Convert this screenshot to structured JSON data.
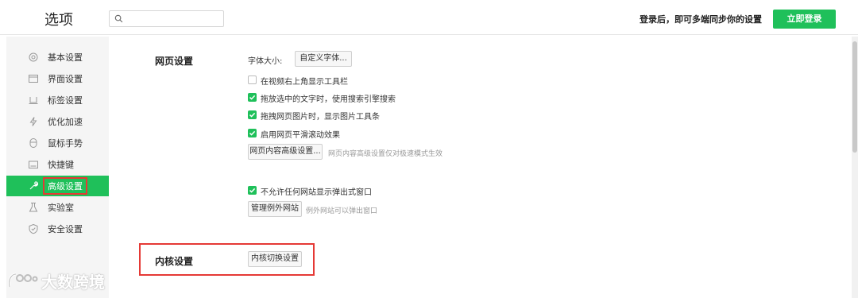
{
  "header": {
    "title": "选项",
    "search_placeholder": "",
    "sync_text": "登录后，即可多端同步你的设置",
    "login_button": "立即登录"
  },
  "sidebar": {
    "items": [
      {
        "label": "基本设置",
        "icon": "circle-icon"
      },
      {
        "label": "界面设置",
        "icon": "window-icon"
      },
      {
        "label": "标签设置",
        "icon": "tab-icon"
      },
      {
        "label": "优化加速",
        "icon": "lightning-icon"
      },
      {
        "label": "鼠标手势",
        "icon": "mouse-icon"
      },
      {
        "label": "快捷键",
        "icon": "keyboard-icon"
      },
      {
        "label": "高级设置",
        "icon": "wrench-icon",
        "active": true
      },
      {
        "label": "实验室",
        "icon": "flask-icon"
      },
      {
        "label": "安全设置",
        "icon": "shield-icon"
      }
    ]
  },
  "webpage_settings": {
    "section_label": "网页设置",
    "font_size_label": "字体大小:",
    "custom_font_button": "自定义字体...",
    "options": [
      {
        "label": "在视频右上角显示工具栏",
        "checked": false
      },
      {
        "label": "拖放选中的文字时，使用搜索引擎搜索",
        "checked": true
      },
      {
        "label": "拖拽网页图片时，显示图片工具条",
        "checked": true
      },
      {
        "label": "启用网页平滑滚动效果",
        "checked": true
      }
    ],
    "advanced_button": "网页内容高级设置...",
    "advanced_hint": "网页内容高级设置仅对极速模式生效",
    "popup_option": {
      "label": "不允许任何网站显示弹出式窗口",
      "checked": true
    },
    "manage_button": "管理例外网站",
    "manage_hint": "例外网站可以弹出窗口"
  },
  "kernel_settings": {
    "section_label": "内核设置",
    "switch_button": "内核切换设置"
  },
  "watermark": {
    "text": "大数跨境"
  },
  "colors": {
    "accent": "#1fc05a",
    "highlight_border": "#e53935"
  }
}
